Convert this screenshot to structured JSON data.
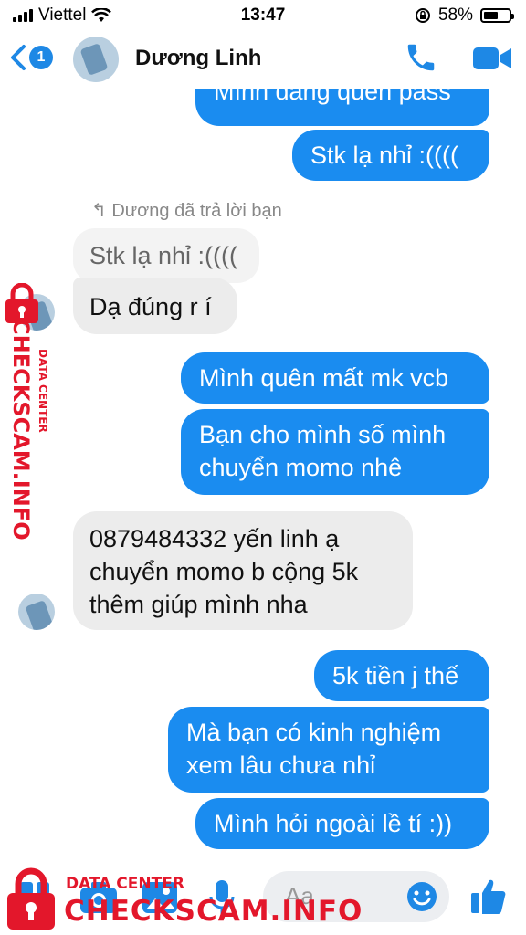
{
  "status_bar": {
    "carrier": "Viettel",
    "time": "13:47",
    "battery": "58%",
    "battery_level": 0.58
  },
  "header": {
    "back_badge": "1",
    "contact_name": "Dương Linh"
  },
  "messages": [
    {
      "side": "out",
      "text": "Mình đang quên pass"
    },
    {
      "side": "out",
      "text": "Stk lạ nhỉ :(((("
    },
    {
      "side": "note",
      "text": "Dương đã trả lời bạn"
    },
    {
      "side": "quoted",
      "text": "Stk lạ nhỉ :(((("
    },
    {
      "side": "in",
      "text": "Dạ đúng r í"
    },
    {
      "side": "out",
      "text": "Mình quên mất mk vcb"
    },
    {
      "side": "out",
      "lines": [
        "Bạn cho mình số mình",
        "chuyển momo nhê"
      ]
    },
    {
      "side": "in",
      "lines": [
        "0879484332 yến linh ạ",
        "chuyển momo b cộng 5k",
        "thêm giúp mình nha"
      ]
    },
    {
      "side": "out",
      "text": "5k tiền j thế"
    },
    {
      "side": "out",
      "lines": [
        "Mà bạn có kinh nghiệm",
        "xem lâu chưa nhỉ"
      ]
    },
    {
      "side": "out",
      "text": "Mình hỏi ngoài lề tí :))"
    }
  ],
  "composer": {
    "placeholder": "Aa"
  },
  "watermark": {
    "line1": "DATA CENTER",
    "line2": "CHECKSCAM.INFO"
  },
  "colors": {
    "accent": "#1a8cf0",
    "incoming_bubble": "#ececec",
    "watermark": "#e3172b"
  },
  "icons": [
    "back-chevron-icon",
    "phone-icon",
    "video-call-icon",
    "grid-icon",
    "camera-icon",
    "photo-icon",
    "microphone-icon",
    "emoji-icon",
    "thumbs-up-icon"
  ]
}
